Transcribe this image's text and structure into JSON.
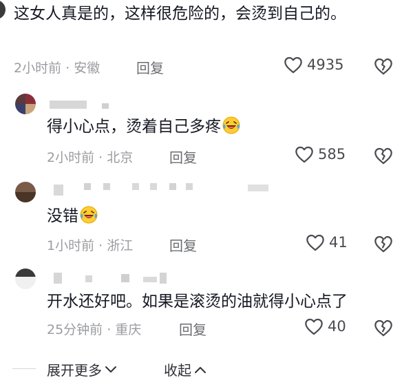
{
  "comments": [
    {
      "text": "这女人真是的，这样很危险的，会烫到自己的。",
      "time": "2小时前",
      "location": "安徽",
      "reply_label": "回复",
      "likes": "4935"
    },
    {
      "text": "得小心点，烫着自己多疼",
      "time": "2小时前",
      "location": "北京",
      "reply_label": "回复",
      "likes": "585"
    },
    {
      "text": "没错",
      "time": "1小时前",
      "location": "浙江",
      "reply_label": "回复",
      "likes": "41"
    },
    {
      "text": "开水还好吧。如果是滚烫的油就得小心点了",
      "time": "25分钟前",
      "location": "重庆",
      "reply_label": "回复",
      "likes": "40"
    }
  ],
  "separator": "·",
  "footer": {
    "expand_label": "展开更多",
    "collapse_label": "收起"
  },
  "icons": {
    "like": "heart-outline-icon",
    "dislike": "broken-heart-icon",
    "emoji": "laughing-tears-emoji",
    "expand": "chevron-down-icon",
    "collapse": "chevron-up-icon"
  }
}
